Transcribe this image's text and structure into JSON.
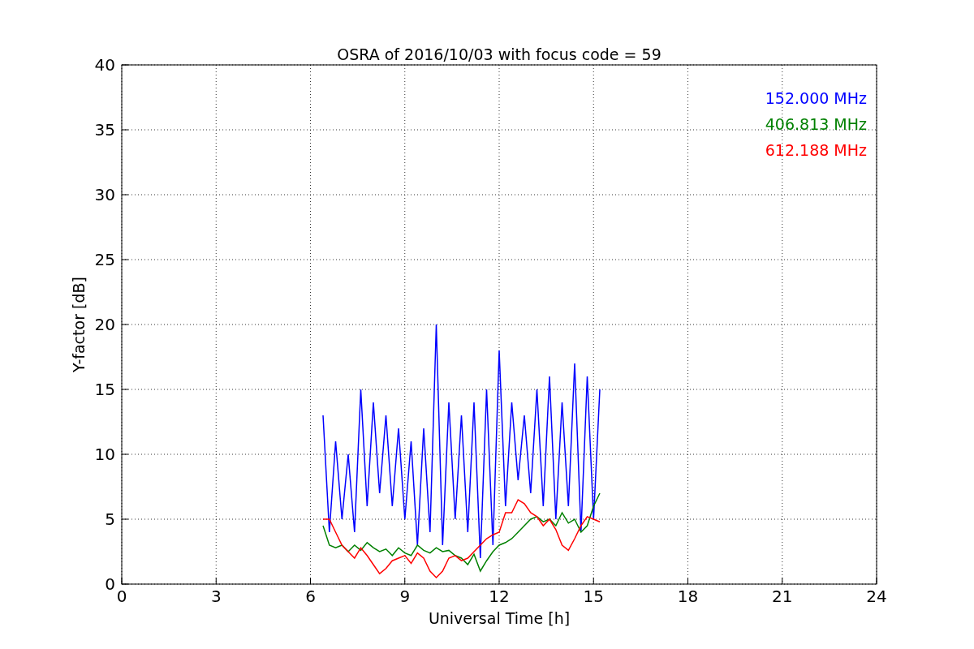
{
  "chart_data": {
    "type": "line",
    "title": "OSRA of 2016/10/03 with focus code = 59",
    "xlabel": "Universal Time [h]",
    "ylabel": "Y-factor [dB]",
    "x": [
      6.4,
      6.6,
      6.8,
      7.0,
      7.2,
      7.4,
      7.6,
      7.8,
      8.0,
      8.2,
      8.4,
      8.6,
      8.8,
      9.0,
      9.2,
      9.4,
      9.6,
      9.8,
      10.0,
      10.2,
      10.4,
      10.6,
      10.8,
      11.0,
      11.2,
      11.4,
      11.6,
      11.8,
      12.0,
      12.2,
      12.4,
      12.6,
      12.8,
      13.0,
      13.2,
      13.4,
      13.6,
      13.8,
      14.0,
      14.2,
      14.4,
      14.6,
      14.8,
      15.0,
      15.2
    ],
    "series": [
      {
        "name": "152.000 MHz",
        "color": "#0000ff",
        "values": [
          13,
          4,
          11,
          5,
          10,
          4,
          15,
          6,
          14,
          7,
          13,
          6,
          12,
          5,
          11,
          3,
          12,
          4,
          20,
          3,
          14,
          5,
          13,
          4,
          14,
          2,
          15,
          3,
          18,
          6,
          14,
          8,
          13,
          7,
          15,
          6,
          16,
          5,
          14,
          6,
          17,
          4,
          16,
          5,
          15
        ]
      },
      {
        "name": "406.813 MHz",
        "color": "#008000",
        "values": [
          4.5,
          3,
          2.8,
          3,
          2.5,
          3,
          2.6,
          3.2,
          2.8,
          2.5,
          2.7,
          2.2,
          2.8,
          2.4,
          2.2,
          3,
          2.6,
          2.4,
          2.8,
          2.5,
          2.6,
          2.2,
          2,
          1.5,
          2.3,
          1,
          1.8,
          2.5,
          3,
          3.2,
          3.5,
          4,
          4.5,
          5,
          5.2,
          4.8,
          5,
          4.5,
          5.5,
          4.7,
          5,
          4,
          4.5,
          6,
          7
        ]
      },
      {
        "name": "612.188 MHz",
        "color": "#ff0000",
        "values": [
          5,
          5,
          4,
          3,
          2.5,
          2,
          2.8,
          2.2,
          1.5,
          0.8,
          1.2,
          1.8,
          2,
          2.2,
          1.6,
          2.4,
          2,
          1,
          0.5,
          1,
          2,
          2.2,
          1.8,
          2,
          2.5,
          3,
          3.5,
          3.8,
          4,
          5.5,
          5.5,
          6.5,
          6.2,
          5.5,
          5.2,
          4.5,
          5,
          4.2,
          3,
          2.6,
          3.5,
          4.5,
          5.2,
          5,
          4.8
        ]
      }
    ],
    "xlim": [
      0,
      24
    ],
    "ylim": [
      0,
      40
    ],
    "xticks": [
      0,
      3,
      6,
      9,
      12,
      15,
      18,
      21,
      24
    ],
    "yticks": [
      0,
      5,
      10,
      15,
      20,
      25,
      30,
      35,
      40
    ],
    "grid": true
  }
}
